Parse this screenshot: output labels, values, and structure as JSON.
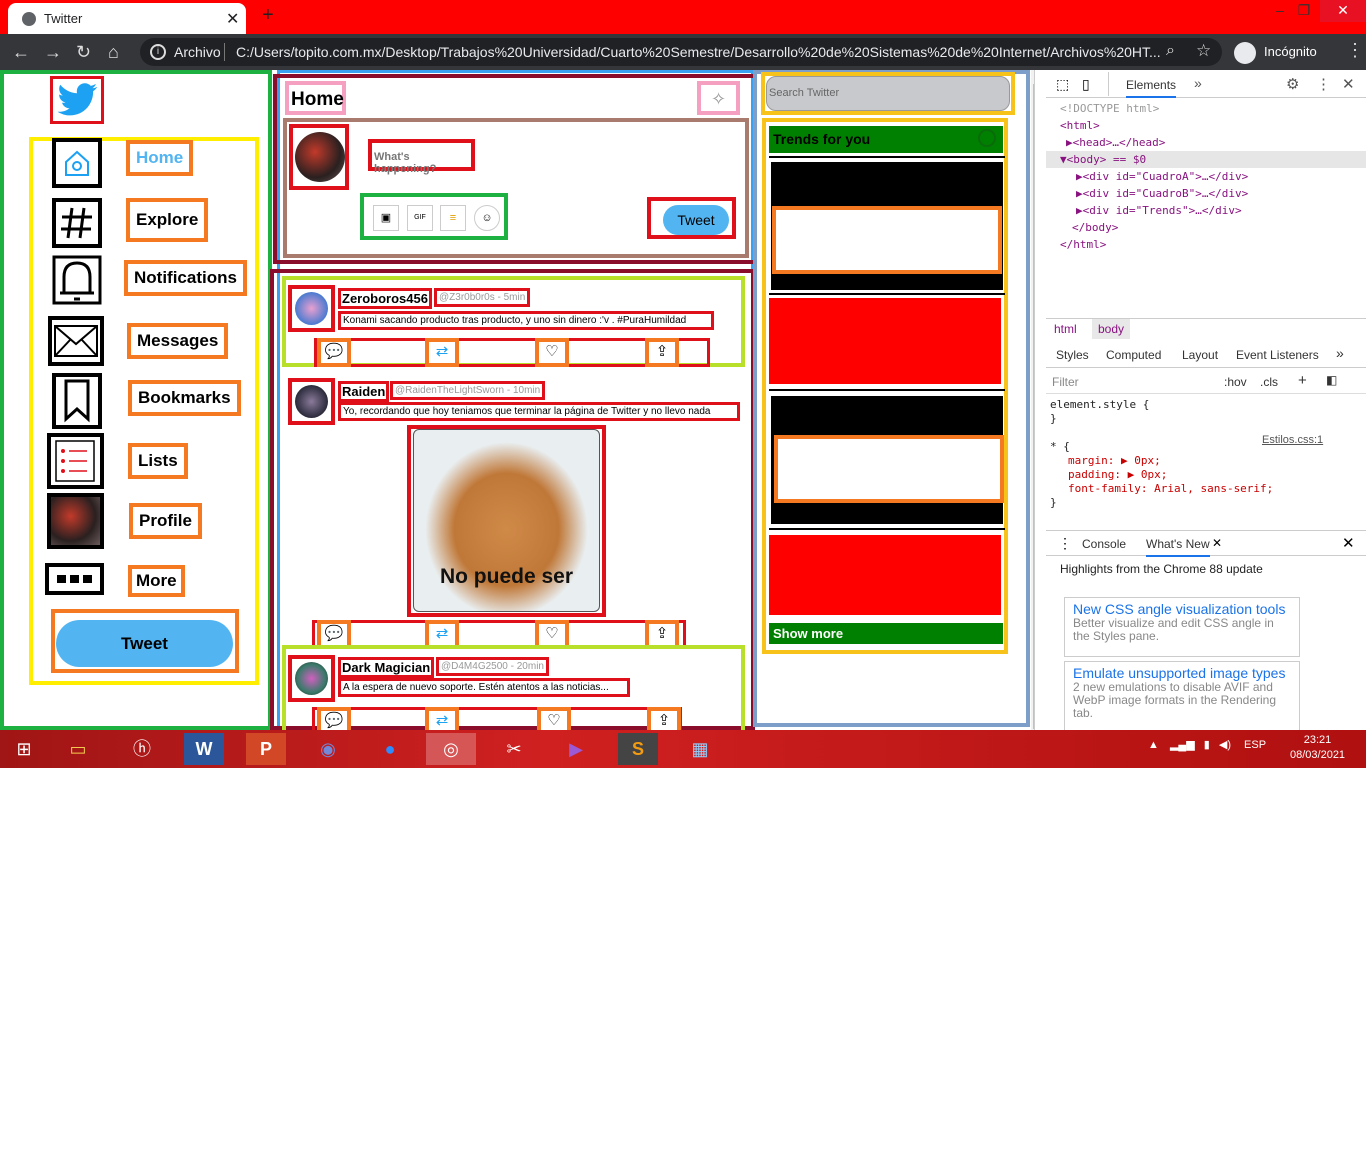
{
  "browser": {
    "tab_title": "Twitter",
    "address_label": "Archivo",
    "url": "C:/Users/topito.com.mx/Desktop/Trabajos%20Universidad/Cuarto%20Semestre/Desarrollo%20de%20Sistemas%20de%20Internet/Archivos%20HT...",
    "profile_label": "Incógnito"
  },
  "sidebar": {
    "items": [
      {
        "label": "Home",
        "icon": "home-icon",
        "active": true
      },
      {
        "label": "Explore",
        "icon": "hashtag-icon"
      },
      {
        "label": "Notifications",
        "icon": "bell-icon"
      },
      {
        "label": "Messages",
        "icon": "mail-icon"
      },
      {
        "label": "Bookmarks",
        "icon": "bookmark-icon"
      },
      {
        "label": "Lists",
        "icon": "list-icon"
      },
      {
        "label": "Profile",
        "icon": "avatar-icon"
      },
      {
        "label": "More",
        "icon": "more-icon"
      }
    ],
    "tweet_label": "Tweet"
  },
  "header": {
    "title": "Home"
  },
  "compose": {
    "placeholder": "What's happening?",
    "tweet_label": "Tweet",
    "tools": [
      "image-icon",
      "gif-icon",
      "poll-icon",
      "emoji-icon"
    ]
  },
  "posts": [
    {
      "name": "Zeroboros456",
      "handle": "@Z3r0b0r0s - 5min",
      "text": "Konami sacando producto tras producto, y uno sin dinero :'v . #PuraHumildad"
    },
    {
      "name": "Raiden",
      "handle": "@RaidenTheLightSworn - 10min",
      "text": "Yo, recordando que hoy teniamos que terminar la página de Twitter y no llevo nada",
      "image_caption": "No puede ser"
    },
    {
      "name": "Dark Magician",
      "handle": "@D4M4G2500 - 20min",
      "text": "A la espera de nuevo soporte. Estén atentos a las noticias..."
    }
  ],
  "right": {
    "search_placeholder": "Search Twitter",
    "trends_title": "Trends for you",
    "show_more": "Show more"
  },
  "devtools": {
    "tabs": [
      "Elements"
    ],
    "tree": [
      "<!DOCTYPE html>",
      "<html>",
      "▶<head>…</head>",
      "▼<body> == $0",
      "▶<div id=\"CuadroA\">…</div>",
      "▶<div id=\"CuadroB\">…</div>",
      "▶<div id=\"Trends\">…</div>",
      "</body>",
      "</html>"
    ],
    "crumbs": [
      "html",
      "body"
    ],
    "subtabs": [
      "Styles",
      "Computed",
      "Layout",
      "Event Listeners"
    ],
    "filter_placeholder": "Filter",
    "hov": ":hov",
    "cls": ".cls",
    "styles": [
      "element.style {",
      "}",
      "* {",
      "margin: ▶ 0px;",
      "padding: ▶ 0px;",
      "font-family: Arial, sans-serif;",
      "}"
    ],
    "style_source": "Estilos.css:1",
    "drawer_tabs": [
      "Console",
      "What's New"
    ],
    "highlights": "Highlights from the Chrome 88 update",
    "cards": [
      {
        "title": "New CSS angle visualization tools",
        "desc": "Better visualize and edit CSS angle in the Styles pane."
      },
      {
        "title": "Emulate unsupported image types",
        "desc": "2 new emulations to disable AVIF and WebP image formats in the Rendering tab."
      }
    ]
  },
  "taskbar": {
    "lang": "ESP",
    "time": "23:21",
    "date": "08/03/2021"
  },
  "colors": {
    "tab_bar": "#ff0000",
    "tweet_button": "#52b4f1",
    "trends_header": "#008000"
  }
}
